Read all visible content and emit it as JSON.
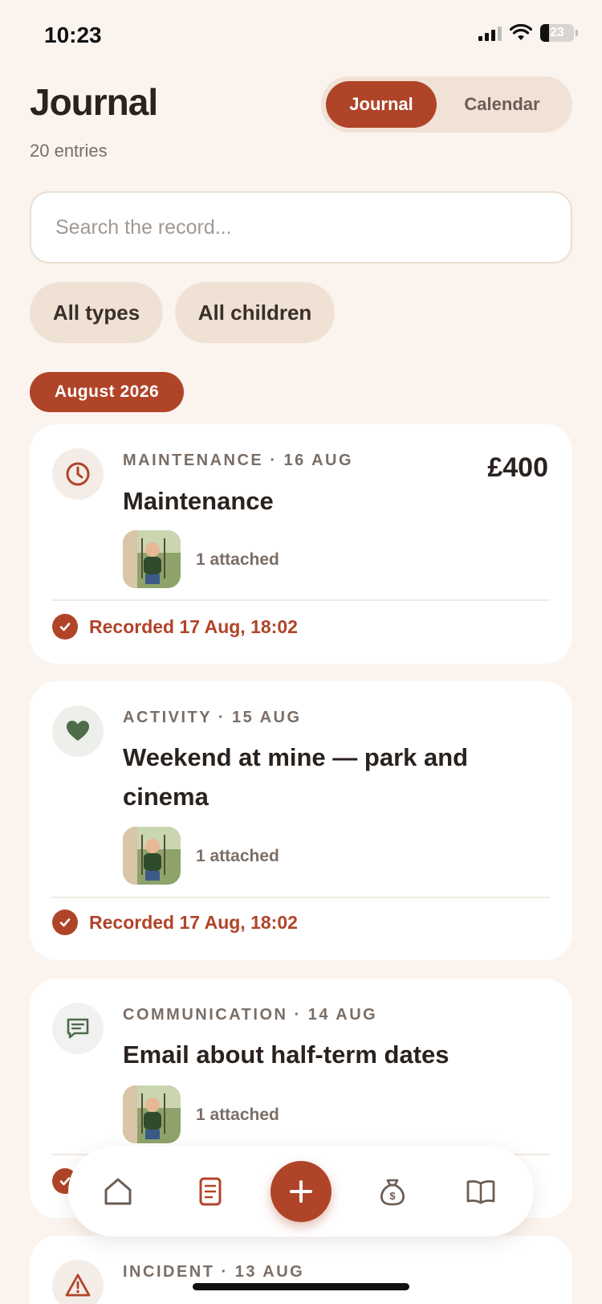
{
  "status_bar": {
    "time": "10:23",
    "battery": "23"
  },
  "header": {
    "title": "Journal",
    "entry_count": "20 entries"
  },
  "view_toggle": {
    "journal_label": "Journal",
    "calendar_label": "Calendar",
    "selected": "Journal"
  },
  "search": {
    "placeholder": "Search the record...",
    "value": ""
  },
  "filters": {
    "type_label": "All types",
    "children_label": "All children"
  },
  "month_label": "August 2026",
  "entries": [
    {
      "meta": "MAINTENANCE · 16 AUG",
      "title": "Maintenance",
      "amount": "£400",
      "attached": "1 attached",
      "recorded": "Recorded 17 Aug, 18:02",
      "icon": "clock-icon"
    },
    {
      "meta": "ACTIVITY · 15 AUG",
      "title": "Weekend at mine — park and cinema",
      "attached": "1 attached",
      "recorded": "Recorded 17 Aug, 18:02",
      "icon": "heart-icon"
    },
    {
      "meta": "COMMUNICATION · 14 AUG",
      "title": "Email about half-term dates",
      "attached": "1 attached",
      "icon": "message-icon"
    },
    {
      "meta": "INCIDENT · 13 AUG",
      "icon": "warning-icon"
    }
  ],
  "nav": {
    "items": [
      "home-icon",
      "journal-icon",
      "add-icon",
      "money-bag-icon",
      "book-icon"
    ],
    "active": "journal-icon"
  },
  "colors": {
    "accent": "#b04428",
    "background": "#fbf4ee",
    "chip": "#efe2d5",
    "card": "#ffffff",
    "activity_green": "#4e6b4a"
  }
}
